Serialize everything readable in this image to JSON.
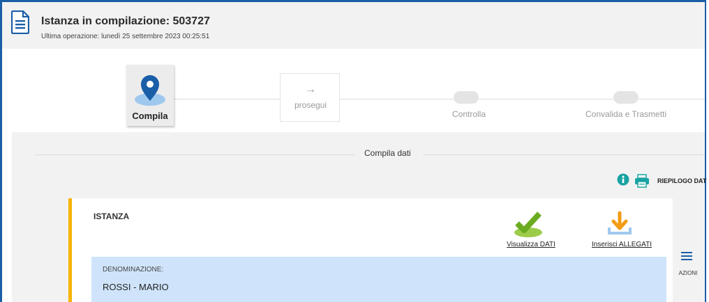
{
  "header": {
    "title": "Istanza in compilazione: 503727",
    "subtitle": "Ultima operazione: lunedì 25 settembre 2023 00:25:51",
    "icon": "document-icon"
  },
  "stepper": {
    "steps": [
      {
        "label": "Compila",
        "state": "active",
        "icon": "map-pin-icon"
      },
      {
        "label": "prosegui",
        "state": "next-button",
        "icon": "arrow-right-icon",
        "arrow": "→"
      },
      {
        "label": "Controlla",
        "state": "pending"
      },
      {
        "label": "Convalida e Trasmetti",
        "state": "pending"
      }
    ]
  },
  "section": {
    "title": "Compila dati",
    "riepilogo_label": "RIEPILOGO DAT"
  },
  "card": {
    "title": "ISTANZA",
    "actions": [
      {
        "label": "Visualizza DATI",
        "icon": "checkmark-icon",
        "color": "#7ab51d"
      },
      {
        "label": "Inserisci ALLEGATI",
        "icon": "download-icon",
        "color": "#f39c12"
      }
    ],
    "field": {
      "label": "DENOMINAZIONE:",
      "value": "ROSSI - MARIO"
    },
    "azioni_label": "AZIONI"
  },
  "colors": {
    "accent": "#1a5ea8",
    "card_border": "#f5b301",
    "field_bg": "#cfe4fa",
    "info": "#1aa3a3"
  }
}
